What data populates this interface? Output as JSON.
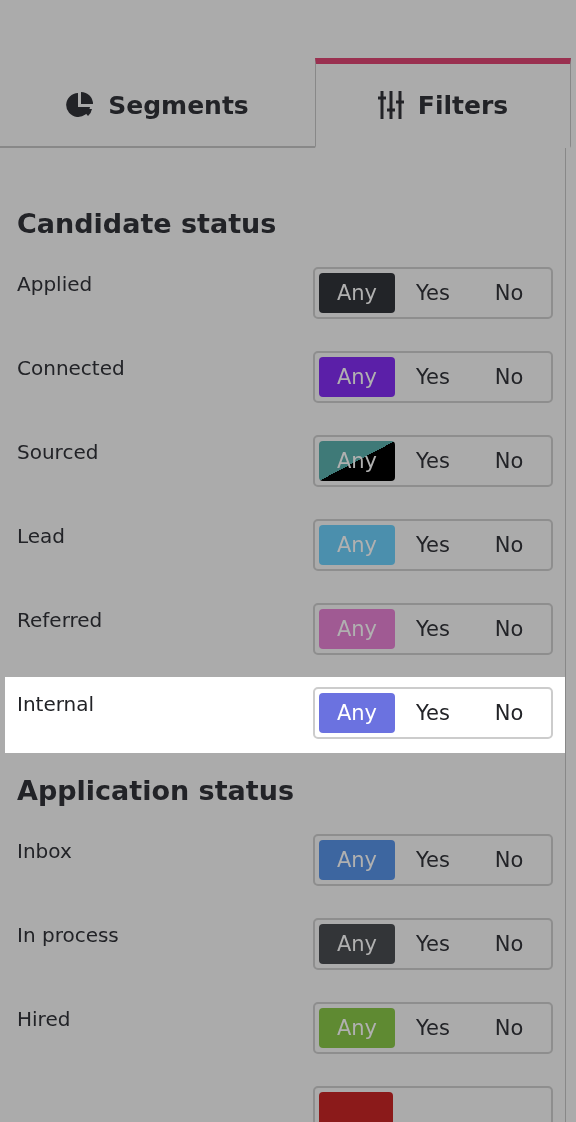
{
  "tabs": [
    {
      "label": "Segments",
      "selected": false
    },
    {
      "label": "Filters",
      "selected": true
    }
  ],
  "sections": [
    {
      "title": "Candidate status",
      "rows": [
        {
          "label": "Applied",
          "kind": "solid",
          "color": "#222428",
          "highlighted": false,
          "options": [
            {
              "label": "Any",
              "selected": true
            },
            {
              "label": "Yes",
              "selected": false
            },
            {
              "label": "No",
              "selected": false
            }
          ]
        },
        {
          "label": "Connected",
          "kind": "solid",
          "color": "#5b1fa8",
          "highlighted": false,
          "options": [
            {
              "label": "Any",
              "selected": true
            },
            {
              "label": "Yes",
              "selected": false
            },
            {
              "label": "No",
              "selected": false
            }
          ]
        },
        {
          "label": "Sourced",
          "kind": "split",
          "color": "#3f7a78",
          "highlighted": false,
          "options": [
            {
              "label": "Any",
              "selected": true
            },
            {
              "label": "Yes",
              "selected": false
            },
            {
              "label": "No",
              "selected": false
            }
          ]
        },
        {
          "label": "Lead",
          "kind": "solid",
          "color": "#4b8fad",
          "highlighted": false,
          "options": [
            {
              "label": "Any",
              "selected": true
            },
            {
              "label": "Yes",
              "selected": false
            },
            {
              "label": "No",
              "selected": false
            }
          ]
        },
        {
          "label": "Referred",
          "kind": "solid",
          "color": "#a05a93",
          "highlighted": false,
          "options": [
            {
              "label": "Any",
              "selected": true
            },
            {
              "label": "Yes",
              "selected": false
            },
            {
              "label": "No",
              "selected": false
            }
          ]
        },
        {
          "label": "Internal",
          "kind": "solid",
          "color": "#6b72e0",
          "highlighted": true,
          "options": [
            {
              "label": "Any",
              "selected": true
            },
            {
              "label": "Yes",
              "selected": false
            },
            {
              "label": "No",
              "selected": false
            }
          ]
        }
      ]
    },
    {
      "title": "Application status",
      "rows": [
        {
          "label": "Inbox",
          "kind": "solid",
          "color": "#3d66a0",
          "highlighted": false,
          "options": [
            {
              "label": "Any",
              "selected": true
            },
            {
              "label": "Yes",
              "selected": false
            },
            {
              "label": "No",
              "selected": false
            }
          ]
        },
        {
          "label": "In process",
          "kind": "solid",
          "color": "#333538",
          "highlighted": false,
          "options": [
            {
              "label": "Any",
              "selected": true
            },
            {
              "label": "Yes",
              "selected": false
            },
            {
              "label": "No",
              "selected": false
            }
          ]
        },
        {
          "label": "Hired",
          "kind": "solid",
          "color": "#5f8a32",
          "highlighted": false,
          "options": [
            {
              "label": "Any",
              "selected": true
            },
            {
              "label": "Yes",
              "selected": false
            },
            {
              "label": "No",
              "selected": false
            }
          ]
        },
        {
          "kind": "cut",
          "color": "#8b1a1a",
          "highlighted": false
        }
      ]
    }
  ]
}
